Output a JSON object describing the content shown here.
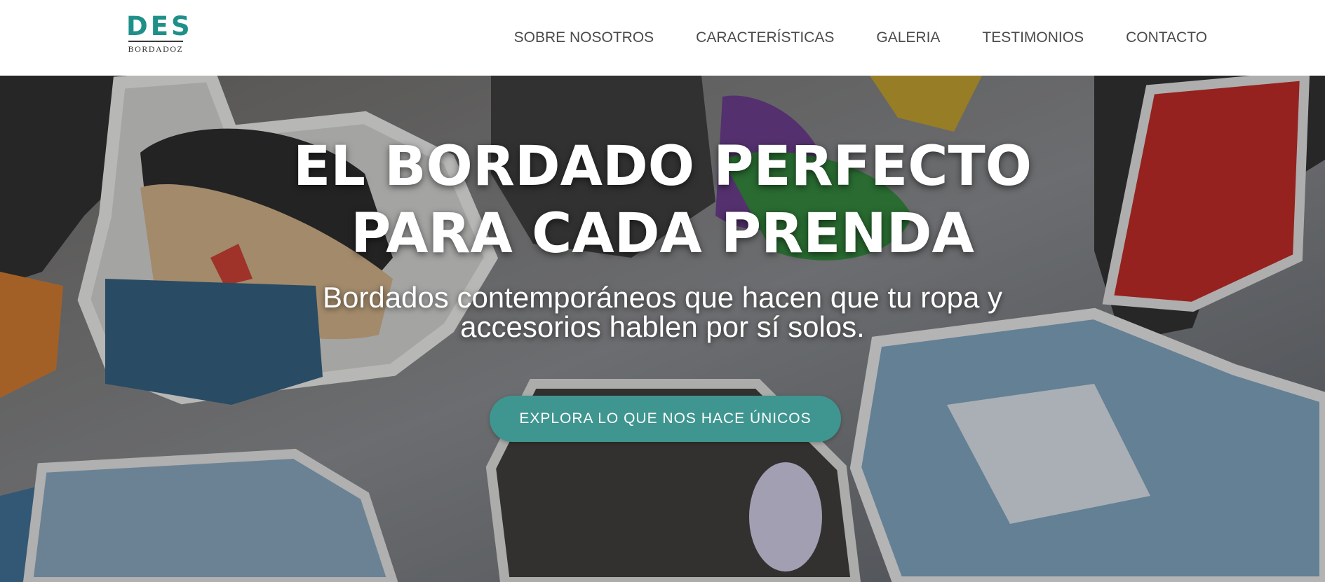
{
  "brand": {
    "logo_mark": "DES",
    "logo_sub": "BORDADOZ",
    "accent_color": "#1e9089"
  },
  "nav": {
    "items": [
      {
        "label": "SOBRE NOSOTROS"
      },
      {
        "label": "CARACTERÍSTICAS"
      },
      {
        "label": "GALERIA"
      },
      {
        "label": "TESTIMONIOS"
      },
      {
        "label": "CONTACTO"
      }
    ]
  },
  "hero": {
    "title_line1": "EL BORDADO PERFECTO",
    "title_line2": "PARA CADA PRENDA",
    "subtitle_line1": "Bordados contemporáneos que hacen que tu ropa y",
    "subtitle_line2": "accesorios hablen por sí solos.",
    "cta_label": "EXPLORA LO QUE NOS HACE ÚNICOS",
    "cta_color": "#3f9690",
    "background_image": "embroidered-patches-collage"
  }
}
